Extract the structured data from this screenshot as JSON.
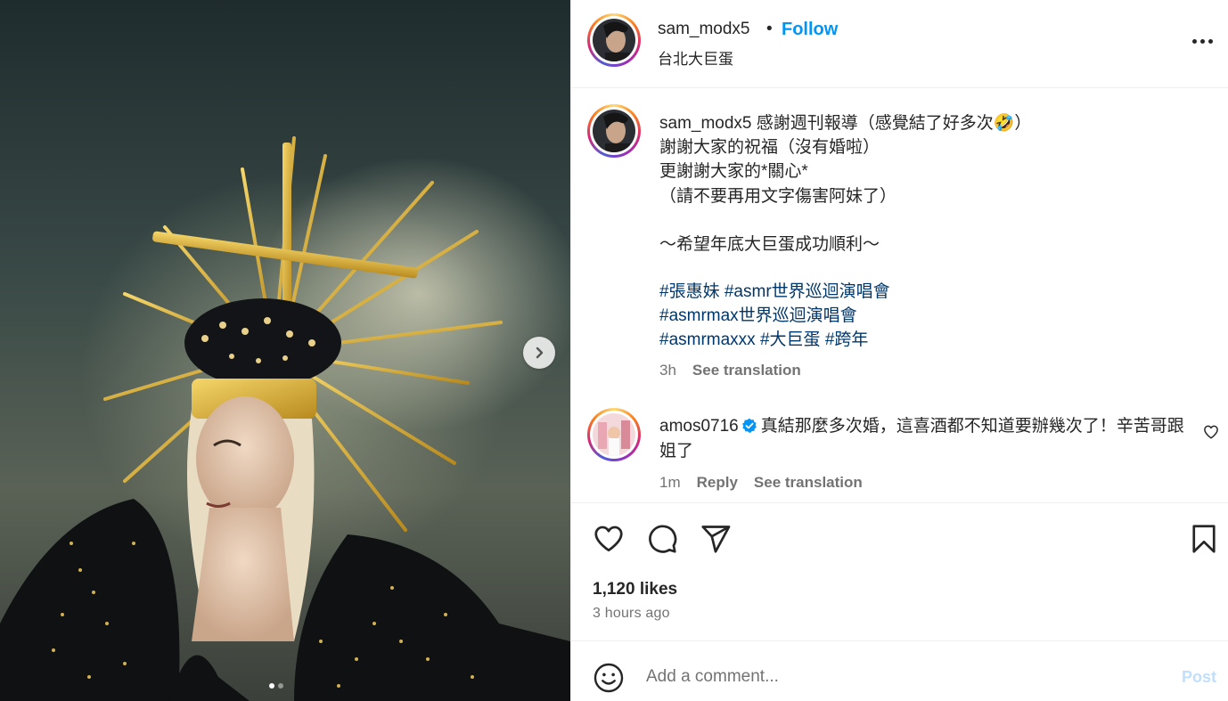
{
  "photo": {
    "carousel_next_icon": "chevron-right-icon",
    "slide_count": 2,
    "active_slide": 1
  },
  "header": {
    "username": "sam_modx5",
    "separator": "•",
    "follow_label": "Follow",
    "location": "台北大巨蛋",
    "more_icon": "more-options-icon"
  },
  "caption": {
    "username": "sam_modx5",
    "text": " 感謝週刊報導（感覺結了好多次🤣）\n謝謝大家的祝福（沒有婚啦）\n更謝謝大家的*關心*\n（請不要再用文字傷害阿妹了）\n\n～希望年底大巨蛋成功順利～",
    "hashtags": {
      "tag1": "#張惠妹",
      "tag2": "#asmr世界巡迴演唱會",
      "tag3": "#asmrmax世界巡迴演唱會",
      "tag4": "#asmrmaxxx",
      "tag5": "#大巨蛋",
      "tag6": "#跨年"
    },
    "time": "3h",
    "see_translation": "See translation"
  },
  "comment": {
    "username": "amos0716",
    "verified": true,
    "text": "真結那麼多次婚，這喜酒都不知道要辦幾次了！辛苦哥跟姐了",
    "time": "1m",
    "reply_label": "Reply",
    "see_translation": "See translation"
  },
  "actions": {
    "likes": "1,120 likes",
    "time_ago": "3 hours ago"
  },
  "add_comment": {
    "placeholder": "Add a comment...",
    "post_label": "Post"
  },
  "colors": {
    "follow_blue": "#0095f6",
    "hashtag_blue": "#00376b",
    "post_disabled": "#c0dffd",
    "muted_text": "#737373",
    "verified_blue": "#0095f6"
  }
}
